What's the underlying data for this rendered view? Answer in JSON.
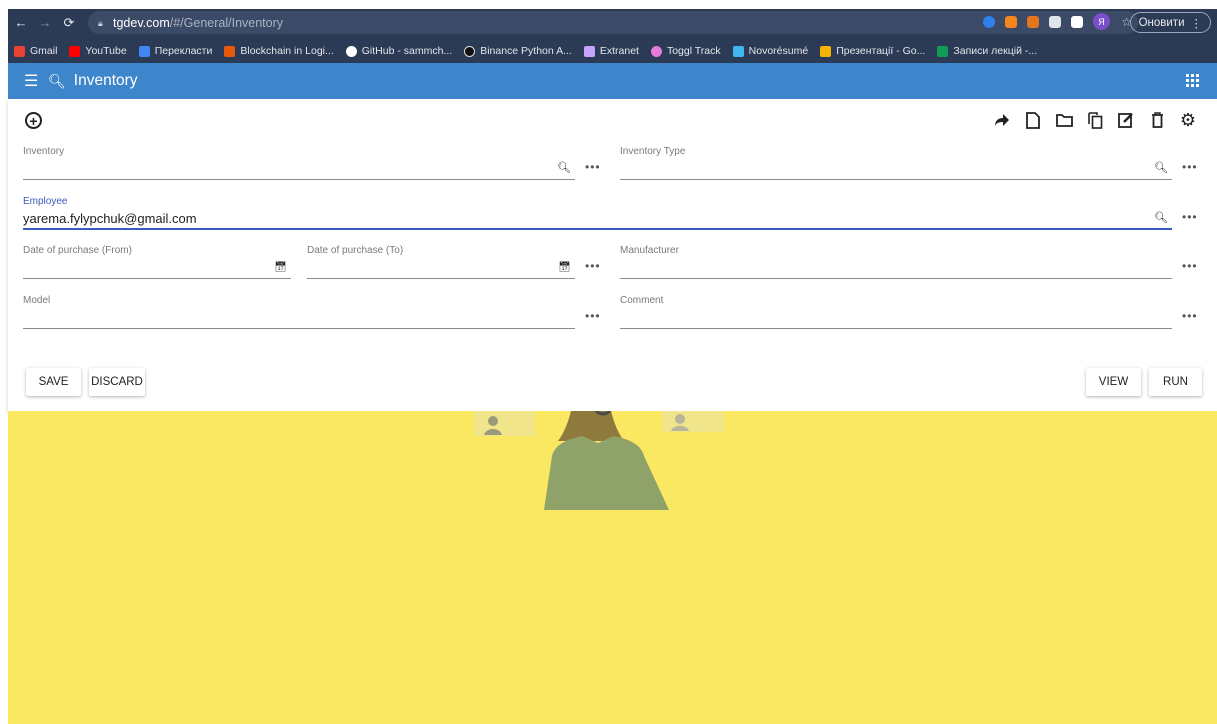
{
  "browser": {
    "url_host": "tgdev.com",
    "url_path": "/#/General/Inventory",
    "update_label": "Оновити",
    "profile_initial": "Я",
    "bookmarks": [
      {
        "label": "Gmail",
        "color": "#e94235"
      },
      {
        "label": "YouTube",
        "color": "#ff0000"
      },
      {
        "label": "Перекласти",
        "color": "#4285f4"
      },
      {
        "label": "Blockchain in Logi...",
        "color": "#e8590c"
      },
      {
        "label": "GitHub - sammch...",
        "color": "#ffffff"
      },
      {
        "label": "Binance Python A...",
        "color": "#222222"
      },
      {
        "label": "Extranet",
        "color": "#c7a3ff"
      },
      {
        "label": "Toggl Track",
        "color": "#e57cd8"
      },
      {
        "label": "Novorésumé",
        "color": "#3fb8f0"
      },
      {
        "label": "Презентації - Go...",
        "color": "#f4b400"
      },
      {
        "label": "Записи лекцій -...",
        "color": "#0f9d58"
      }
    ]
  },
  "appbar": {
    "title": "Inventory"
  },
  "form": {
    "inventory_label": "Inventory",
    "inventory_type_label": "Inventory Type",
    "employee_label": "Employee",
    "employee_value": "yarema.fylypchuk@gmail.com",
    "date_from_label": "Date of purchase (From)",
    "date_to_label": "Date of purchase (To)",
    "manufacturer_label": "Manufacturer",
    "model_label": "Model",
    "comment_label": "Comment"
  },
  "buttons": {
    "save": "SAVE",
    "discard": "DISCARD",
    "view": "VIEW",
    "run": "RUN"
  },
  "colors": {
    "appbar": "#3d86cb",
    "accent": "#3b5bbf",
    "background": "#fbe862"
  }
}
